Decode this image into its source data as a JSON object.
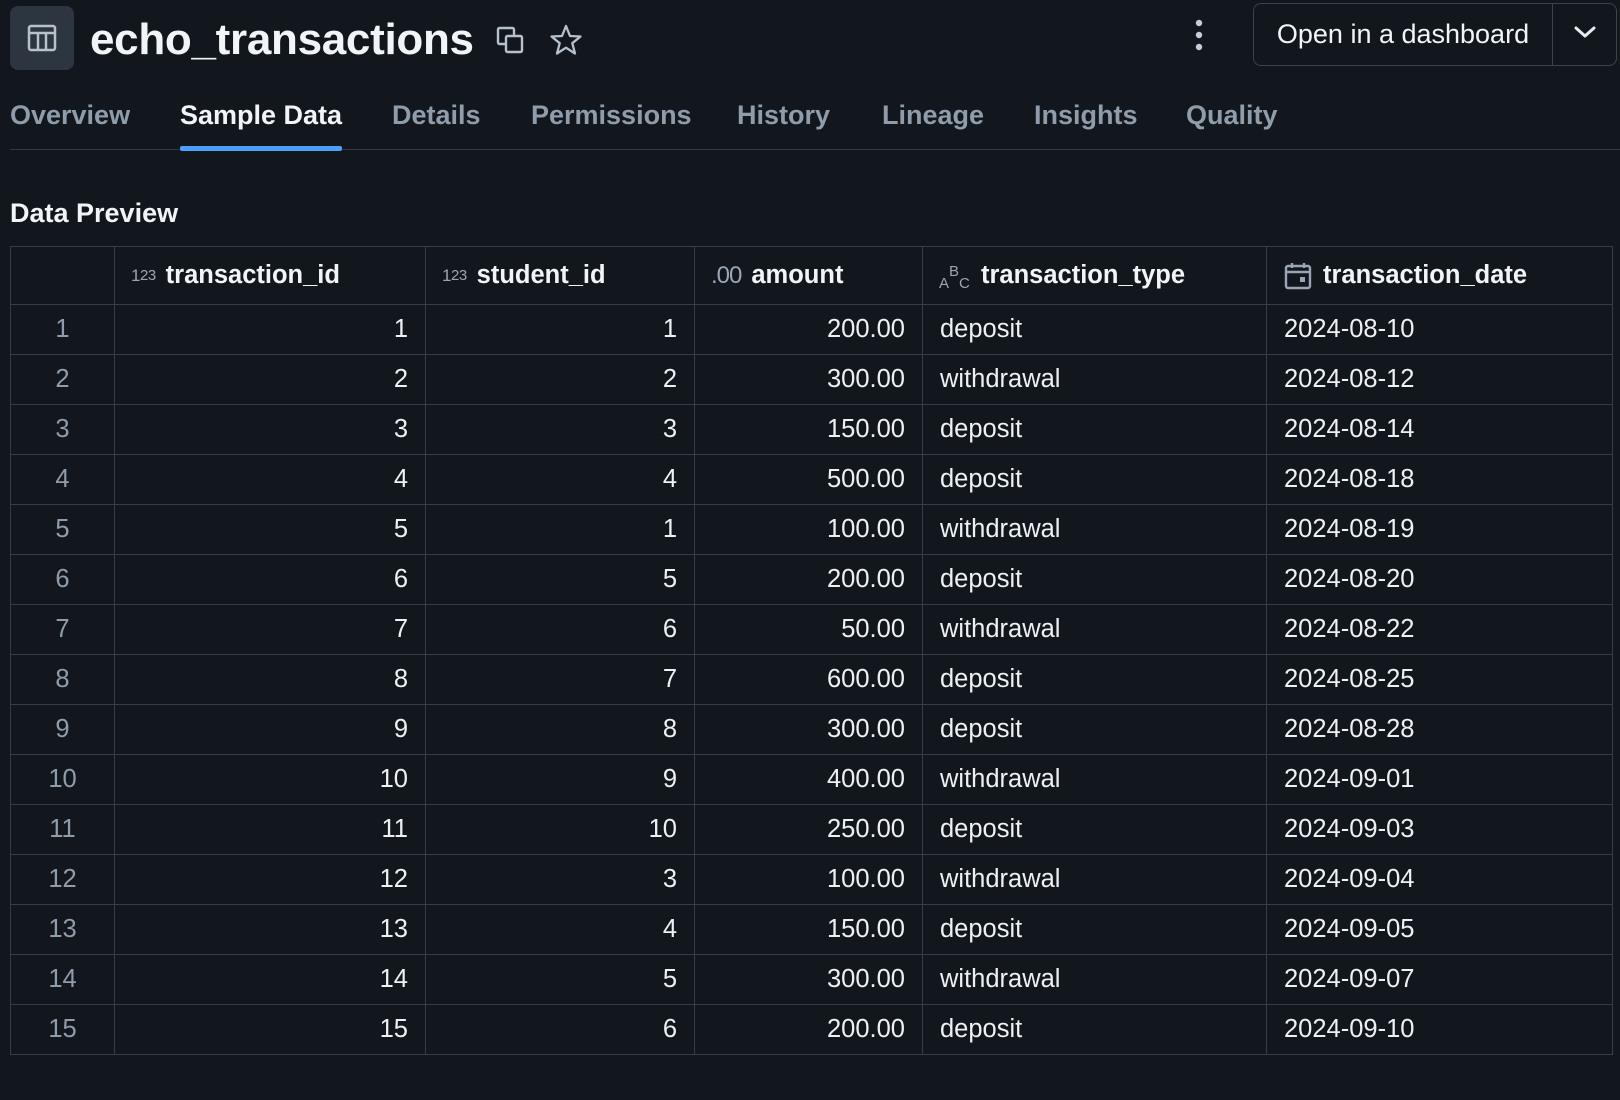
{
  "header": {
    "title": "echo_transactions",
    "open_dashboard_label": "Open in a dashboard"
  },
  "tabs": [
    {
      "label": "Overview",
      "active": false
    },
    {
      "label": "Sample Data",
      "active": true
    },
    {
      "label": "Details",
      "active": false
    },
    {
      "label": "Permissions",
      "active": false
    },
    {
      "label": "History",
      "active": false
    },
    {
      "label": "Lineage",
      "active": false
    },
    {
      "label": "Insights",
      "active": false
    },
    {
      "label": "Quality",
      "active": false
    }
  ],
  "preview": {
    "title": "Data Preview",
    "columns": [
      {
        "name": "transaction_id",
        "type_icon": "integer-icon"
      },
      {
        "name": "student_id",
        "type_icon": "integer-icon"
      },
      {
        "name": "amount",
        "type_icon": "decimal-icon"
      },
      {
        "name": "transaction_type",
        "type_icon": "string-icon"
      },
      {
        "name": "transaction_date",
        "type_icon": "calendar-icon"
      }
    ],
    "rows": [
      {
        "row_num": "1",
        "transaction_id": "1",
        "student_id": "1",
        "amount": "200.00",
        "transaction_type": "deposit",
        "transaction_date": "2024-08-10"
      },
      {
        "row_num": "2",
        "transaction_id": "2",
        "student_id": "2",
        "amount": "300.00",
        "transaction_type": "withdrawal",
        "transaction_date": "2024-08-12"
      },
      {
        "row_num": "3",
        "transaction_id": "3",
        "student_id": "3",
        "amount": "150.00",
        "transaction_type": "deposit",
        "transaction_date": "2024-08-14"
      },
      {
        "row_num": "4",
        "transaction_id": "4",
        "student_id": "4",
        "amount": "500.00",
        "transaction_type": "deposit",
        "transaction_date": "2024-08-18"
      },
      {
        "row_num": "5",
        "transaction_id": "5",
        "student_id": "1",
        "amount": "100.00",
        "transaction_type": "withdrawal",
        "transaction_date": "2024-08-19"
      },
      {
        "row_num": "6",
        "transaction_id": "6",
        "student_id": "5",
        "amount": "200.00",
        "transaction_type": "deposit",
        "transaction_date": "2024-08-20"
      },
      {
        "row_num": "7",
        "transaction_id": "7",
        "student_id": "6",
        "amount": "50.00",
        "transaction_type": "withdrawal",
        "transaction_date": "2024-08-22"
      },
      {
        "row_num": "8",
        "transaction_id": "8",
        "student_id": "7",
        "amount": "600.00",
        "transaction_type": "deposit",
        "transaction_date": "2024-08-25"
      },
      {
        "row_num": "9",
        "transaction_id": "9",
        "student_id": "8",
        "amount": "300.00",
        "transaction_type": "deposit",
        "transaction_date": "2024-08-28"
      },
      {
        "row_num": "10",
        "transaction_id": "10",
        "student_id": "9",
        "amount": "400.00",
        "transaction_type": "withdrawal",
        "transaction_date": "2024-09-01"
      },
      {
        "row_num": "11",
        "transaction_id": "11",
        "student_id": "10",
        "amount": "250.00",
        "transaction_type": "deposit",
        "transaction_date": "2024-09-03"
      },
      {
        "row_num": "12",
        "transaction_id": "12",
        "student_id": "3",
        "amount": "100.00",
        "transaction_type": "withdrawal",
        "transaction_date": "2024-09-04"
      },
      {
        "row_num": "13",
        "transaction_id": "13",
        "student_id": "4",
        "amount": "150.00",
        "transaction_type": "deposit",
        "transaction_date": "2024-09-05"
      },
      {
        "row_num": "14",
        "transaction_id": "14",
        "student_id": "5",
        "amount": "300.00",
        "transaction_type": "withdrawal",
        "transaction_date": "2024-09-07"
      },
      {
        "row_num": "15",
        "transaction_id": "15",
        "student_id": "6",
        "amount": "200.00",
        "transaction_type": "deposit",
        "transaction_date": "2024-09-10"
      }
    ]
  },
  "colors": {
    "background": "#12171e",
    "accent": "#4c9eff",
    "border": "#343e49",
    "muted_text": "#8f9caa"
  }
}
